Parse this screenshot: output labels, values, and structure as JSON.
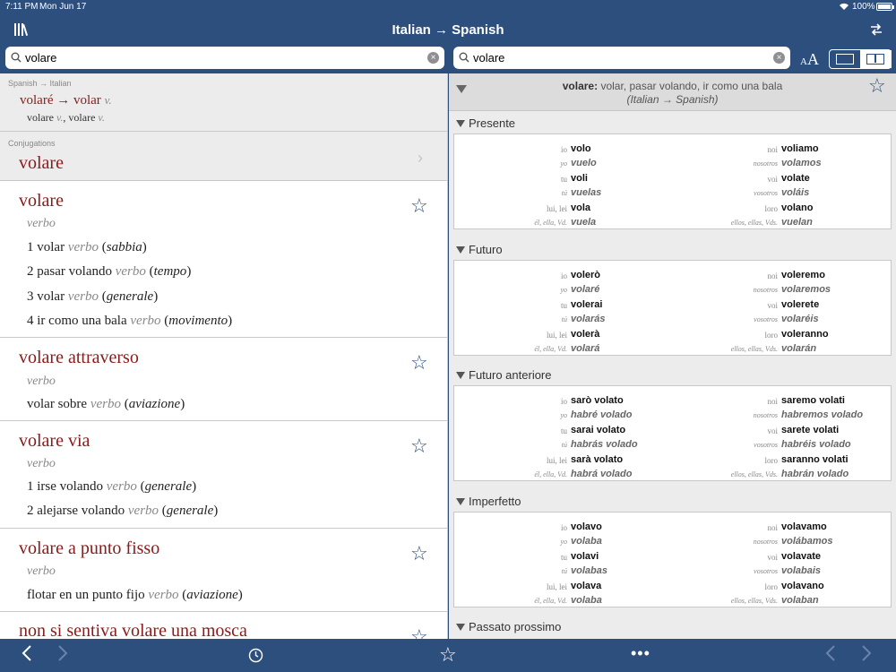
{
  "status_bar": {
    "time": "7:11 PM",
    "date": "Mon Jun 17",
    "battery": "100%"
  },
  "nav": {
    "title": "Italian → Spanish"
  },
  "search_left": {
    "value": "volare"
  },
  "search_right": {
    "value": "volare"
  },
  "font_size_control": {
    "small": "A",
    "big": "A"
  },
  "suggestion": {
    "label": "Spanish → Italian",
    "line1_word": "volaré",
    "line1_arrow": "→",
    "line1_target": "volar",
    "line1_pos": "v.",
    "line2_a": "volare",
    "line2_a_pos": "v.",
    "line2_sep": ",",
    "line2_b": "volare",
    "line2_b_pos": "v."
  },
  "conjugations_row": {
    "label": "Conjugations",
    "word": "volare"
  },
  "entries": [
    {
      "headword": "volare",
      "pos": "verbo",
      "senses": [
        {
          "num": "1",
          "text": "volar",
          "pos": "verbo",
          "ctx": "sabbia"
        },
        {
          "num": "2",
          "text": "pasar volando",
          "pos": "verbo",
          "ctx": "tempo"
        },
        {
          "num": "3",
          "text": "volar",
          "pos": "verbo",
          "ctx": "generale"
        },
        {
          "num": "4",
          "text": "ir como una bala",
          "pos": "verbo",
          "ctx": "movimento"
        }
      ]
    },
    {
      "headword": "volare attraverso",
      "pos": "verbo",
      "senses": [
        {
          "num": "",
          "text": "volar sobre",
          "pos": "verbo",
          "ctx": "aviazione"
        }
      ]
    },
    {
      "headword": "volare via",
      "pos": "verbo",
      "senses": [
        {
          "num": "1",
          "text": "irse volando",
          "pos": "verbo",
          "ctx": "generale"
        },
        {
          "num": "2",
          "text": "alejarse volando",
          "pos": "verbo",
          "ctx": "generale"
        }
      ]
    },
    {
      "headword": "volare a punto fisso",
      "pos": "verbo",
      "senses": [
        {
          "num": "",
          "text": "flotar en un punto fijo",
          "pos": "verbo",
          "ctx": "aviazione"
        }
      ]
    },
    {
      "headword": "non si sentiva volare una mosca",
      "pos": "",
      "senses": []
    }
  ],
  "conjugation_panel": {
    "header_word": "volare:",
    "header_translations": "volar, pasar volando, ir como una bala",
    "header_direction": "(Italian → Spanish)",
    "tenses": [
      {
        "name": "Presente",
        "rows": [
          {
            "lp": "io",
            "lf": "volo",
            "rp": "noi",
            "rf": "voliamo",
            "lang": "it"
          },
          {
            "lp": "yo",
            "lf": "vuelo",
            "rp": "nosotros",
            "rf": "volamos",
            "lang": "es"
          },
          {
            "lp": "tu",
            "lf": "voli",
            "rp": "voi",
            "rf": "volate",
            "lang": "it"
          },
          {
            "lp": "tú",
            "lf": "vuelas",
            "rp": "vosotros",
            "rf": "voláis",
            "lang": "es"
          },
          {
            "lp": "lui, lei",
            "lf": "vola",
            "rp": "loro",
            "rf": "volano",
            "lang": "it"
          },
          {
            "lp": "él, ella, Vd.",
            "lf": "vuela",
            "rp": "ellos, ellas, Vds.",
            "rf": "vuelan",
            "lang": "es"
          }
        ]
      },
      {
        "name": "Futuro",
        "rows": [
          {
            "lp": "io",
            "lf": "volerò",
            "rp": "noi",
            "rf": "voleremo",
            "lang": "it"
          },
          {
            "lp": "yo",
            "lf": "volaré",
            "rp": "nosotros",
            "rf": "volaremos",
            "lang": "es"
          },
          {
            "lp": "tu",
            "lf": "volerai",
            "rp": "voi",
            "rf": "volerete",
            "lang": "it"
          },
          {
            "lp": "tú",
            "lf": "volarás",
            "rp": "vosotros",
            "rf": "volaréis",
            "lang": "es"
          },
          {
            "lp": "lui, lei",
            "lf": "volerà",
            "rp": "loro",
            "rf": "voleranno",
            "lang": "it"
          },
          {
            "lp": "él, ella, Vd.",
            "lf": "volará",
            "rp": "ellos, ellas, Vds.",
            "rf": "volarán",
            "lang": "es"
          }
        ]
      },
      {
        "name": "Futuro anteriore",
        "rows": [
          {
            "lp": "io",
            "lf": "sarò volato",
            "rp": "noi",
            "rf": "saremo volati",
            "lang": "it"
          },
          {
            "lp": "yo",
            "lf": "habré volado",
            "rp": "nosotros",
            "rf": "habremos volado",
            "lang": "es"
          },
          {
            "lp": "tu",
            "lf": "sarai volato",
            "rp": "voi",
            "rf": "sarete volati",
            "lang": "it"
          },
          {
            "lp": "tú",
            "lf": "habrás volado",
            "rp": "vosotros",
            "rf": "habréis volado",
            "lang": "es"
          },
          {
            "lp": "lui, lei",
            "lf": "sarà volato",
            "rp": "loro",
            "rf": "saranno volati",
            "lang": "it"
          },
          {
            "lp": "él, ella, Vd.",
            "lf": "habrá volado",
            "rp": "ellos, ellas, Vds.",
            "rf": "habrán volado",
            "lang": "es"
          }
        ]
      },
      {
        "name": "Imperfetto",
        "rows": [
          {
            "lp": "io",
            "lf": "volavo",
            "rp": "noi",
            "rf": "volavamo",
            "lang": "it"
          },
          {
            "lp": "yo",
            "lf": "volaba",
            "rp": "nosotros",
            "rf": "volábamos",
            "lang": "es"
          },
          {
            "lp": "tu",
            "lf": "volavi",
            "rp": "voi",
            "rf": "volavate",
            "lang": "it"
          },
          {
            "lp": "tú",
            "lf": "volabas",
            "rp": "vosotros",
            "rf": "volabais",
            "lang": "es"
          },
          {
            "lp": "lui, lei",
            "lf": "volava",
            "rp": "loro",
            "rf": "volavano",
            "lang": "it"
          },
          {
            "lp": "él, ella, Vd.",
            "lf": "volaba",
            "rp": "ellos, ellas, Vds.",
            "rf": "volaban",
            "lang": "es"
          }
        ]
      },
      {
        "name": "Passato prossimo",
        "rows": []
      }
    ]
  },
  "toolbar": {
    "more": "•••"
  },
  "colors": {
    "bar_blue": "#2d4f7e",
    "headword_red": "#8b1a1a",
    "panel_grey": "#ececec"
  }
}
